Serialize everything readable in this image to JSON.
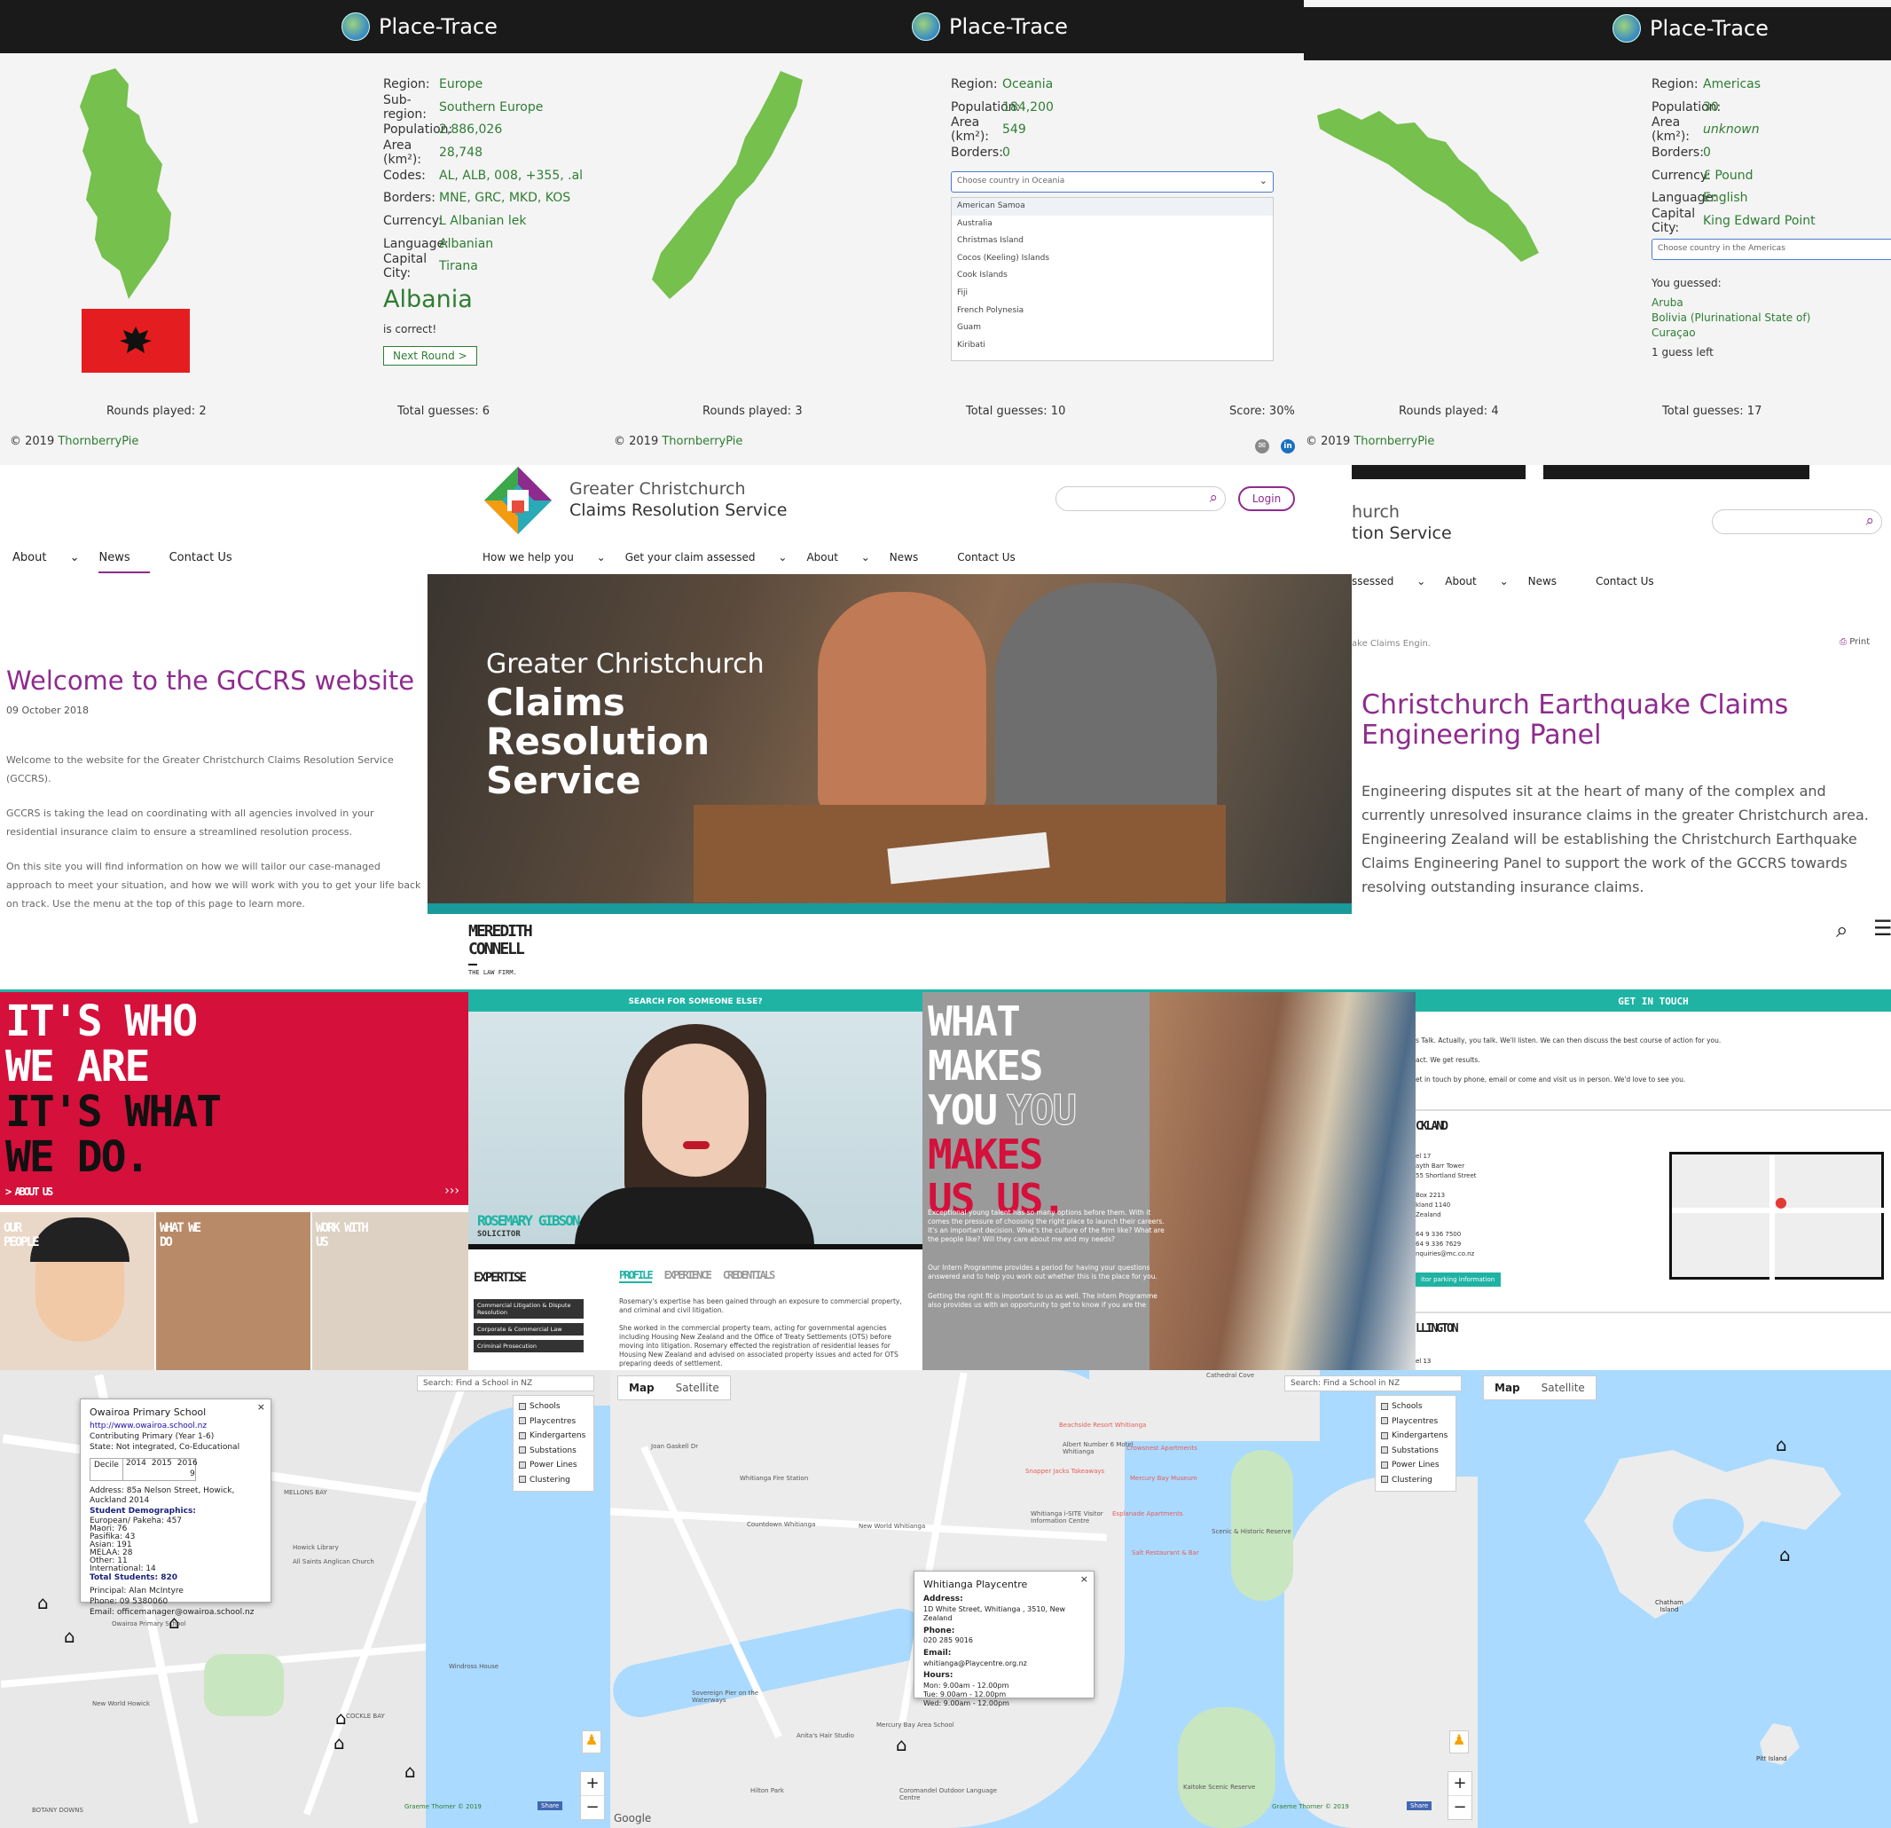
{
  "placetrace": {
    "brand": "Place-Trace",
    "panel1": {
      "rows": [
        {
          "k": "Region:",
          "v": "Europe"
        },
        {
          "k": "Sub-region:",
          "v": "Southern Europe"
        },
        {
          "k": "Population:",
          "v": "2,886,026"
        },
        {
          "k": "Area (km²):",
          "v": "28,748"
        },
        {
          "k": "Codes:",
          "v": "AL, ALB, 008, +355, .al"
        },
        {
          "k": "Borders:",
          "v": "MNE, GRC, MKD, KOS"
        },
        {
          "k": "Currency:",
          "v": "L Albanian lek"
        },
        {
          "k": "Language:",
          "v": "Albanian"
        },
        {
          "k": "Capital City:",
          "v": "Tirana"
        }
      ],
      "country": "Albania",
      "result": "is correct!",
      "next": "Next Round >",
      "rounds": "Rounds played: 2",
      "guesses": "Total guesses: 6",
      "copyright": "© 2019",
      "owner": "ThornberryPie"
    },
    "panel2": {
      "rows": [
        {
          "k": "Region:",
          "v": "Oceania"
        },
        {
          "k": "Population:",
          "v": "184,200"
        },
        {
          "k": "Area (km²):",
          "v": "549"
        },
        {
          "k": "Borders:",
          "v": "0"
        }
      ],
      "select_placeholder": "Choose country in Oceania",
      "options": [
        "American Samoa",
        "Australia",
        "Christmas Island",
        "Cocos (Keeling) Islands",
        "Cook Islands",
        "Fiji",
        "French Polynesia",
        "Guam",
        "Kiribati"
      ],
      "rounds": "Rounds played: 3",
      "guesses": "Total guesses: 10",
      "score": "Score: 30%",
      "copyright": "© 2019",
      "owner": "ThornberryPie"
    },
    "panel3": {
      "rows": [
        {
          "k": "Region:",
          "v": "Americas"
        },
        {
          "k": "Population:",
          "v": "30"
        },
        {
          "k": "Area (km²):",
          "v": "unknown"
        },
        {
          "k": "Borders:",
          "v": "0"
        },
        {
          "k": "Currency:",
          "v": "£ Pound"
        },
        {
          "k": "Language:",
          "v": "English"
        },
        {
          "k": "Capital City:",
          "v": "King Edward Point"
        }
      ],
      "select_placeholder": "Choose country in the Americas",
      "you_guessed": "You guessed:",
      "guesses_list": [
        "Aruba",
        "Bolivia (Plurinational State of)",
        "Curaçao"
      ],
      "left": "1 guess left",
      "rounds": "Rounds played: 4",
      "guesses": "Total guesses: 17",
      "copyright": "© 2019",
      "owner": "ThornberryPie"
    }
  },
  "gccrs": {
    "logo_line1": "Greater Christchurch",
    "logo_line2": "Claims Resolution Service",
    "login": "Login",
    "nav_main": [
      "How we help you",
      "Get your claim assessed",
      "About",
      "News",
      "Contact Us"
    ],
    "nav_left": [
      "About",
      "News",
      "Contact Us"
    ],
    "nav_right": [
      "ssessed",
      "About",
      "News",
      "Contact Us"
    ],
    "hero_line1": "Greater Christchurch",
    "hero_line2": "Claims",
    "hero_line3": "Resolution",
    "hero_line4": "Service",
    "welcome_title": "Welcome to the GCCRS website",
    "welcome_date": "09 October 2018",
    "welcome_p1": "Welcome to the website for the Greater Christchurch Claims Resolution Service (GCCRS).",
    "welcome_p2": "GCCRS is taking the lead on coordinating with all agencies involved in your residential insurance claim to ensure a streamlined resolution process.",
    "welcome_p3": "On this site you will find information on how we will tailor our case-managed approach to meet your situation, and how we will work with you to get your life back on track.  Use the menu at the top of this page to learn more.",
    "right_logo1": "hurch",
    "right_logo2": "tion Service",
    "crumb": "ake Claims Engin.",
    "print": "Print",
    "panel_title": "Christchurch Earthquake Claims Engineering Panel",
    "panel_text": "Engineering disputes sit at the heart of many of the complex and currently unresolved insurance claims in the greater Christchurch area. Engineering Zealand will be establishing the Christchurch Earthquake Claims Engineering Panel to support the work of the GCCRS towards resolving outstanding insurance claims."
  },
  "mc": {
    "logo1": "MEREDITH",
    "logo2": "CONNELL",
    "logo3": "THE LAW FIRM.",
    "h1": [
      "IT'S WHO",
      "WE ARE",
      "IT'S WHAT",
      "WE DO."
    ],
    "about": "> ABOUT US",
    "tiles": [
      "OUR PEOPLE",
      "WHAT WE DO",
      "WORK WITH US"
    ],
    "search_banner": "SEARCH FOR SOMEONE ELSE?",
    "person_name": "ROSEMARY GIBSON",
    "person_role": "SOLICITOR",
    "expertise": "EXPERTISE",
    "expertise_items": [
      "Commercial Litigation & Dispute Resolution",
      "Corporate & Commercial Law",
      "Criminal Prosecution"
    ],
    "tabs": [
      "PROFILE",
      "EXPERIENCE",
      "CREDENTIALS"
    ],
    "profile_p1": "Rosemary's expertise has been gained through an exposure to commercial property, and criminal and civil litigation.",
    "profile_p2": "She worked in the commercial property team, acting for governmental agencies including Housing New Zealand and the Office of Treaty Settlements (OTS) before moving into litigation. Rosemary effected the registration of residential leases for Housing New Zealand and advised on associated property issues and acted for OTS preparing deeds of settlement.",
    "what1": [
      "WHAT",
      "MAKES",
      "YOU"
    ],
    "what_you": "YOU",
    "what2": [
      "MAKES",
      "US US."
    ],
    "intern_p1": "Exceptional young talent has so many options before them. With it comes the pressure of choosing the right place to launch their careers. It's an important decision. What's the culture of the firm like? What are the people like? Will they care about me and my needs?",
    "intern_p2": "Our Intern Programme provides a period for having your questions answered and to help you work out whether this is the place for you.",
    "intern_p3": "Getting the right fit is important to us as well. The Intern Programme also provides us with an opportunity to get to know if you are the",
    "get_in_touch": "GET IN TOUCH",
    "touch_p1": "s Talk. Actually, you talk. We'll listen. We can then discuss the best course of action for you.",
    "touch_p2": "act. We get results.",
    "touch_p3": "et in touch by phone, email or come and visit us in person. We'd love to see you.",
    "auckland": "CKLAND",
    "address": [
      "el 17",
      "ayth Barr Tower",
      "55 Shortland Street",
      "",
      "Box 2213",
      "kland 1140",
      "Zealand",
      "",
      "64 9 336 7500",
      "64 9 336 7629",
      "nquiries@mc.co.nz"
    ],
    "visitor": "itor parking information",
    "wellington": "LLINGTON",
    "well_addr": "el 13"
  },
  "maps": {
    "search_label": "Search:",
    "search_placeholder": "Find a School in NZ",
    "layers": [
      "Schools",
      "Playcentres",
      "Kindergartens",
      "Substations",
      "Power Lines",
      "Clustering"
    ],
    "tab_map": "Map",
    "tab_sat": "Satellite",
    "credit": "Graeme Thorner © 2019",
    "share": "Share",
    "google": "Google",
    "school_popup": {
      "title": "Owairoa Primary School",
      "url": "http://www.owairoa.school.nz",
      "lines": [
        "Contributing Primary (Year 1-6)",
        "State: Not integrated, Co-Educational"
      ],
      "decile_label": "Decile",
      "years": [
        "2014",
        "2015",
        "2016"
      ],
      "decile": "9",
      "address": "Address: 85a Nelson Street, Howick, Auckland 2014",
      "demo_title": "Student Demographics:",
      "demo": [
        "European/ Pakeha: 457",
        "Maori: 76",
        "Pasifika: 43",
        "Asian: 191",
        "MELAA: 28",
        "Other: 11",
        "International: 14"
      ],
      "total": "Total Students: 820",
      "principal": "Principal: Alan McIntyre",
      "phone": "Phone: 09 5380060",
      "email": "Email: officemanager@owairoa.school.nz"
    },
    "play_popup": {
      "title": "Whitianga Playcentre",
      "addr_h": "Address:",
      "addr": "1D White Street, Whitianga , 3510, New Zealand",
      "phone_h": "Phone:",
      "phone": "020 285 9016",
      "email_h": "Email:",
      "email": "whitianga@Playcentre.org.nz",
      "hours_h": "Hours:",
      "hours": [
        "Mon:  9.00am - 12.00pm",
        "Tue:  9.00am - 12.00pm",
        "Wed:  9.00am - 12.00pm"
      ]
    },
    "labels1": [
      "MELLONS BAY",
      "COCKLE BAY",
      "BOTANY DOWNS",
      "Howick Library",
      "All Saints Anglican Church",
      "Owairoa Primary School",
      "Windross House",
      "New World Howick",
      "Botany Downs",
      "Cockle Bay"
    ],
    "labels2": [
      "Joan Gaskell Dr",
      "Whitianga Fire Station",
      "Countdown Whitianga",
      "New World Whitianga",
      "Whitianga i-SITE Visitor Information Centre",
      "Sovereign Pier on the Waterways",
      "Anita's Hair Studio",
      "Mercury Bay Area School",
      "Hilton Park",
      "Coromandel Outdoor Language Centre",
      "Mercury Bay Museum",
      "Esplanade Apartments",
      "Salt Restaurant & Bar",
      "Snapper Jacks Takeaways",
      "Crowsnest Apartments",
      "Beachside Resort Whitianga",
      "Albert Number 6 Motel Whitianga",
      "Kaitoke Scenic Reserve",
      "Scenic & Historic Reserve",
      "Cathedral Cove"
    ],
    "labels3": [
      "Chatham Island",
      "Pitt Island"
    ]
  }
}
